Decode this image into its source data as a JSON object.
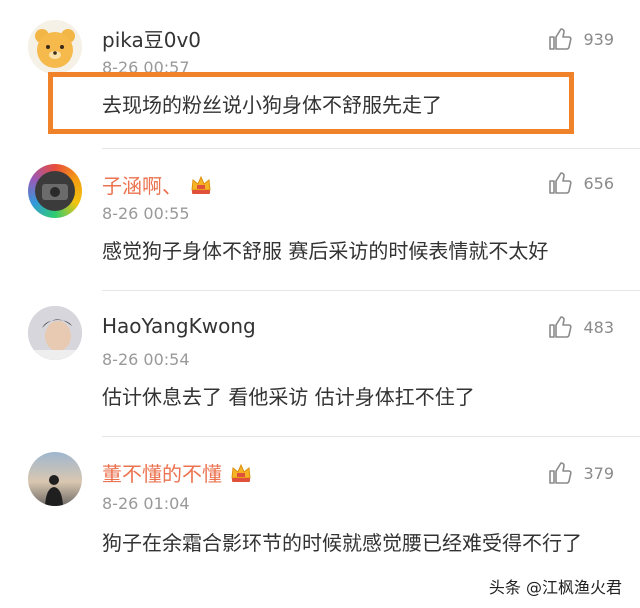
{
  "comments": [
    {
      "username": "pika豆0v0",
      "timestamp": "8-26 00:57",
      "text": "去现场的粉丝说小狗身体不舒服先走了",
      "likes": "939",
      "vip": false,
      "avatar": "bear-avatar",
      "highlighted": true
    },
    {
      "username": "子涵啊、",
      "timestamp": "8-26 00:55",
      "text": "感觉狗子身体不舒服 赛后采访的时候表情就不太好",
      "likes": "656",
      "vip": true,
      "avatar": "rainbow-avatar"
    },
    {
      "username": "HaoYangKwong",
      "timestamp": "8-26 00:54",
      "text": "估计休息去了  看他采访   估计身体扛不住了",
      "likes": "483",
      "vip": false,
      "avatar": "portrait-avatar"
    },
    {
      "username": "董不懂的不懂",
      "timestamp": "8-26 01:04",
      "text": "狗子在余霜合影环节的时候就感觉腰已经难受得不行了",
      "likes": "379",
      "vip": true,
      "avatar": "silhouette-avatar"
    }
  ],
  "watermark": "头条 @江枫渔火君",
  "colors": {
    "vip_name": "#eb7350",
    "highlight": "#f0832a",
    "meta": "#999999"
  }
}
